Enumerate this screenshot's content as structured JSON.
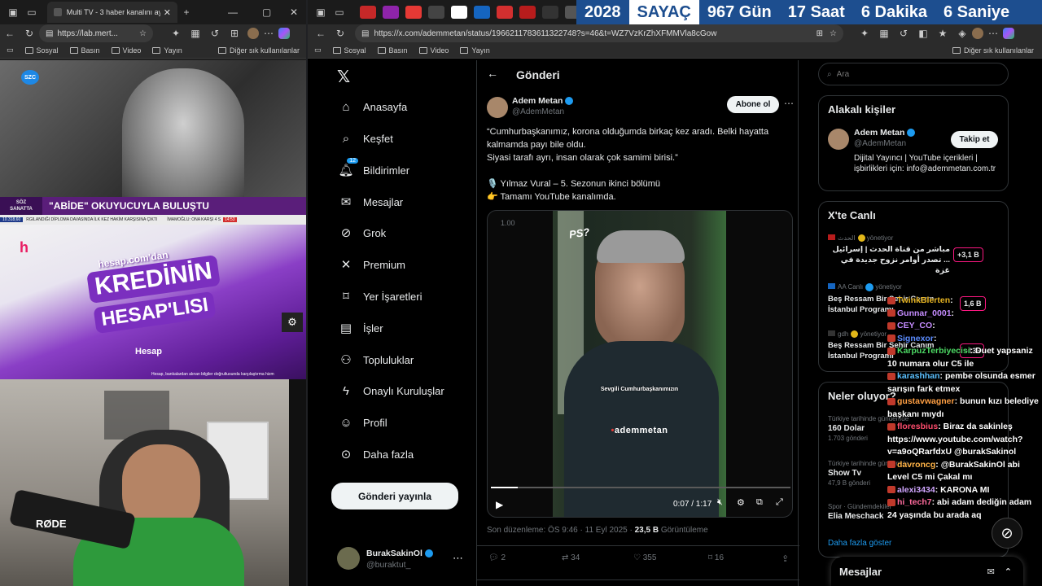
{
  "left_browser": {
    "tab_title": "Multi TV - 3 haber kanalını aynı a",
    "url": "https://lab.mert...",
    "favorites": [
      "Sosyal",
      "Basın",
      "Video",
      "Yayın"
    ],
    "other_favorites": "Diğer sık kullanılanlar"
  },
  "tv": {
    "channel_logo": "SZC",
    "band_tag_top": "SÖZ",
    "band_tag_bottom": "SANATTA",
    "band_text": "\"ABİDE\" OKUYUCUYLA BULUŞTU",
    "ticker_left": "10.318,60",
    "ticker_text": "RGILANDIĞI DİPLOMA DAVASINDA İLK KEZ HAKİM KARŞISINA ÇIKTI",
    "ticker_right": "İMAMOĞLU: ONA KARŞI 4 S",
    "ticker_time": "14:53",
    "ad_line1": "hesap.com'dan",
    "ad_line2": "KREDİNİN",
    "ad_line3": "HESAP'LISI",
    "ad_brand": "Hesap",
    "ad_disclaimer": "Hesap, bankalardan alınan bilgiler doğrultusunda karşılaştırma hizm",
    "cam_mic": "RØDE"
  },
  "right_browser": {
    "url": "https://x.com/ademmetan/status/1966211783611322748?s=46&t=WZ7VzKrZhXFMMVla8cGow",
    "favorites": [
      "Sosyal",
      "Basın",
      "Video",
      "Yayın"
    ],
    "other_favorites": "Diğer sık kullanılanlar"
  },
  "countdown": {
    "year": "2028",
    "label": "SAYAÇ",
    "days": "967 Gün",
    "hours": "17 Saat",
    "minutes": "6 Dakika",
    "seconds": "6 Saniye"
  },
  "nav": {
    "items": [
      "Anasayfa",
      "Keşfet",
      "Bildirimler",
      "Mesajlar",
      "Grok",
      "Premium",
      "Yer İşaretleri",
      "İşler",
      "Topluluklar",
      "Onaylı Kuruluşlar",
      "Profil",
      "Daha fazla"
    ],
    "notif_badge": "12",
    "post_button": "Gönderi yayınla",
    "user_name": "BurakSakinOl",
    "user_handle": "@buraktut_"
  },
  "post": {
    "header": "Gönderi",
    "author": "Adem Metan",
    "handle": "@AdemMetan",
    "subscribe": "Abone ol",
    "text1": "“Cumhurbaşkanımız, korona olduğumda birkaç kez aradı. Belki hayatta kalmamda payı bile oldu.",
    "text2": "Siyasi tarafı ayrı, insan olarak çok samimi birisi.”",
    "text3": "🎙️ Yılmaz Vural – 5. Sezonun ikinci bölümü",
    "text4": "👉 Tamamı YouTube kanalımda.",
    "video_speed": "1.00",
    "video_ps": "PS?",
    "video_caption": "Sevgili Cumhurbaşkanımızın",
    "video_watermark": "ademmetan",
    "video_time": "0:07 / 1:17",
    "video_progress": 0.09,
    "edited": "Son düzenleme: ÖS 9:46 · 11 Eyl 2025 ·",
    "views": "23,5 B",
    "views_label": "Görüntüleme",
    "replies": "2",
    "reposts": "34",
    "likes": "355",
    "bookmarks": "16"
  },
  "sidebar": {
    "search_placeholder": "Ara",
    "related_title": "Alakalı kişiler",
    "related_name": "Adem Metan",
    "related_handle": "@AdemMetan",
    "follow": "Takip et",
    "related_bio": "Dijital Yayıncı | YouTube içerikleri | işbirlikleri için: info@ademmetan.com.tr",
    "live_title": "X'te Canlı",
    "live": [
      {
        "host": "الحدث",
        "status": "yönetiyor",
        "title": "مباشر من قناة الحدث | إسرائيل ... تصدر أوامر نزوح جديدة في غزة",
        "count": "+3,1 B"
      },
      {
        "host": "AA Canlı",
        "status": "yönetiyor",
        "title": "Beş Ressam Bir Şehir Canım İstanbul Programı",
        "count": "1,6 B"
      },
      {
        "host": "gdh",
        "status": "yönetiyor",
        "title": "Beş Ressam Bir Şehir Canım İstanbul Programı",
        "count": "+136"
      }
    ],
    "trends_title": "Neler oluyor?",
    "trends": [
      {
        "meta": "Türkiye tarihinde gündemde",
        "name": "160 Dolar",
        "count": "1.703 gönderi"
      },
      {
        "meta": "Türkiye tarihinde gündemde",
        "name": "Show Tv",
        "count": "47,9 B gönderi"
      },
      {
        "meta": "Spor · Gündemdekiler",
        "name": "Elia Meschack",
        "count": ""
      }
    ],
    "show_more": "Daha fazla göster",
    "messages": "Mesajlar"
  },
  "chat": [
    {
      "user": "TwinkBlerten",
      "msg": "",
      "color": "#e6b422"
    },
    {
      "user": "Gunnar_0001",
      "msg": "",
      "color": "#c58cff"
    },
    {
      "user": "CEY_CO",
      "msg": "",
      "color": "#c58cff"
    },
    {
      "user": "Signexor",
      "msg": "",
      "color": "#5b8cff"
    },
    {
      "user": "KarpuzTerbiyecisi",
      "msg": "Duet yapsaniz 10 numara olur C5 ile",
      "color": "#4cd964"
    },
    {
      "user": "karashhan",
      "msg": "pembe olsunda esmer sarışın fark etmex",
      "color": "#5bc0ff"
    },
    {
      "user": "gustavwagner",
      "msg": "bunun kızı belediye başkanı mıydı",
      "color": "#ff9f43"
    },
    {
      "user": "floresbius",
      "msg": "Biraz da sakinleş https://www.youtube.com/watch?v=a9oQRarfdxU @burakSakinol",
      "color": "#ff4d6d"
    },
    {
      "user": "davroncg",
      "msg": "@BurakSakinOl abi Level C5 mi Çakal mı",
      "color": "#ffb347"
    },
    {
      "user": "alexi3434",
      "msg": "KARONA MI",
      "color": "#d0a6ff"
    },
    {
      "user": "hi_tech7",
      "msg": "abi adam dediğin adam 24 yaşında bu arada aq",
      "color": "#ff6b9d"
    }
  ]
}
